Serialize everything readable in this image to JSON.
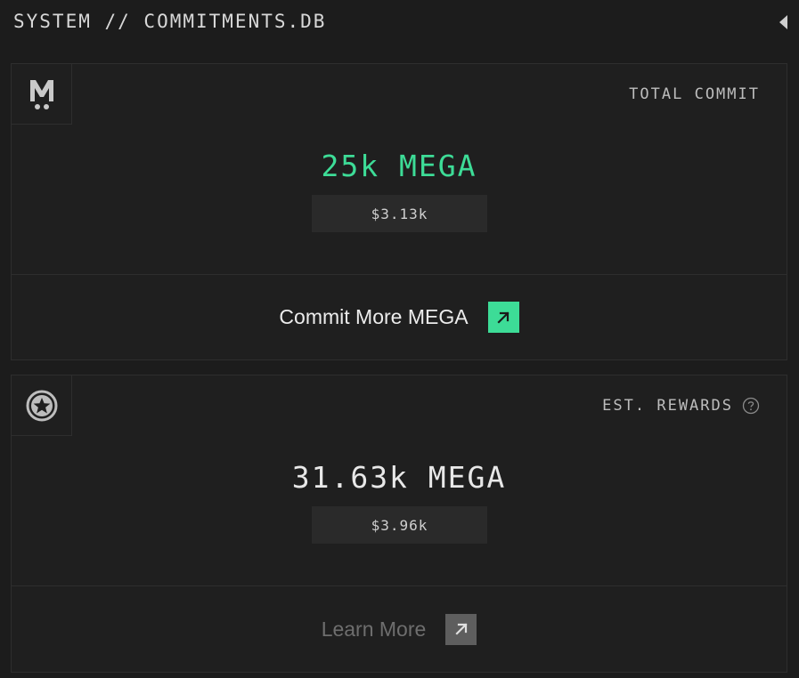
{
  "header": {
    "title": "SYSTEM // COMMITMENTS.DB",
    "collapse_icon": "caret-left-icon"
  },
  "commit_card": {
    "logo_icon": "mega-logo-icon",
    "label": "TOTAL COMMIT",
    "amount": "25k MEGA",
    "usd_value": "$3.13k",
    "cta_label": "Commit More MEGA",
    "cta_icon": "arrow-up-right-icon"
  },
  "rewards_card": {
    "logo_icon": "star-badge-icon",
    "label": "EST. REWARDS",
    "help_icon": "question-circle-icon",
    "amount": "31.63k MEGA",
    "usd_value": "$3.96k",
    "cta_label": "Learn More",
    "cta_icon": "arrow-up-right-icon"
  },
  "colors": {
    "background": "#1c1c1c",
    "accent_green": "#3ddc97",
    "border": "#2e2e2e",
    "muted_text": "#6e6e6e"
  }
}
